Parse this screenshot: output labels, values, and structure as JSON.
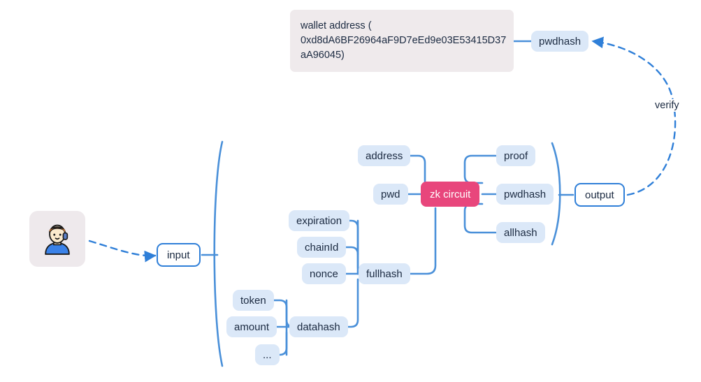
{
  "diagram": {
    "title": "zk circuit input/output flow",
    "colors": {
      "background": "#ffffff",
      "edge": "#4a90d9",
      "chip_bg": "#dbe8f8",
      "chip_text": "#1b2a41",
      "accent_bg": "#e8467c",
      "accent_text": "#ffffff",
      "outline_border": "#2f7fd8",
      "note_bg": "#efeaec",
      "avatar_tile_bg": "#eee9ec"
    },
    "note": {
      "name": "wallet-address-note",
      "text": "wallet address (\n0xd8dA6BF26964aF9D7eEd9e03E53415D37\naA96045)"
    },
    "avatar": {
      "name": "user-avatar",
      "glyph": "user-icon"
    },
    "nodes": {
      "input": "input",
      "output": "output",
      "zk_circuit": "zk circuit",
      "address": "address",
      "pwd": "pwd",
      "proof": "proof",
      "pwdhash_out": "pwdhash",
      "allhash": "allhash",
      "pwdhash_top": "pwdhash",
      "expiration": "expiration",
      "chainid": "chainId",
      "nonce": "nonce",
      "fullhash": "fullhash",
      "token": "token",
      "amount": "amount",
      "ellipsis": "...",
      "datahash": "datahash"
    },
    "edge_labels": {
      "verify": "verify"
    }
  }
}
